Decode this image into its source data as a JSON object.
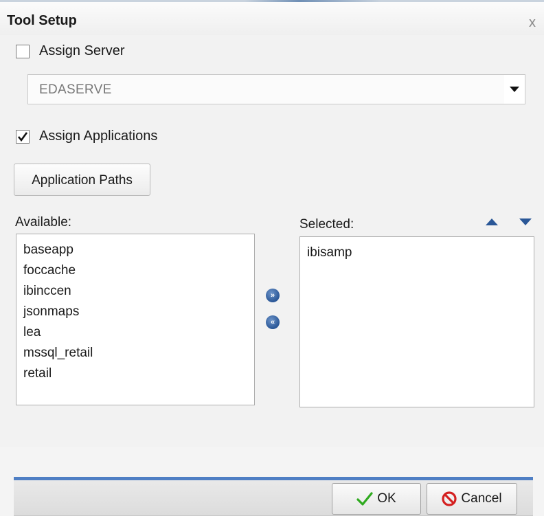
{
  "dialog": {
    "title": "Tool Setup",
    "close_icon": "x",
    "assign_server": {
      "label": "Assign Server",
      "checked": false
    },
    "server_select": {
      "value": "EDASERVE"
    },
    "assign_applications": {
      "label": "Assign Applications",
      "checked": true
    },
    "application_paths_button": "Application Paths",
    "available": {
      "label": "Available:",
      "items": [
        "baseapp",
        "foccache",
        "ibinccen",
        "jsonmaps",
        "lea",
        "mssql_retail",
        "retail"
      ]
    },
    "selected": {
      "label": "Selected:",
      "items": [
        "ibisamp"
      ]
    },
    "move_right_icon": "»",
    "move_left_icon": "«",
    "ok_button": "OK",
    "cancel_button": "Cancel"
  },
  "colors": {
    "accent_blue": "#4f7fc4",
    "icon_blue": "#2a5797",
    "ok_green": "#2faa1f",
    "cancel_red": "#d42020"
  }
}
